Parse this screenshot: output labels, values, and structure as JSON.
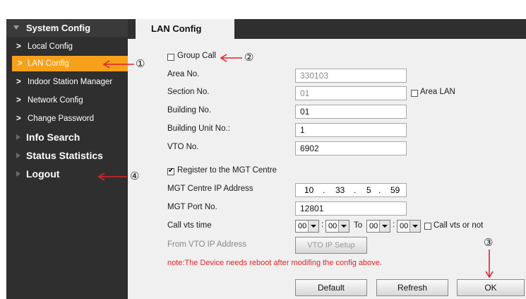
{
  "sidebar": {
    "header": "System Config",
    "sub_items": [
      "Local Config",
      "LAN Config",
      "Indoor Station Manager",
      "Network Config",
      "Change Password"
    ],
    "main_items": [
      "Info Search",
      "Status Statistics",
      "Logout"
    ]
  },
  "tab": {
    "label": "LAN Config"
  },
  "form": {
    "group_call": "Group Call",
    "area_no_label": "Area No.",
    "area_no_value": "330103",
    "section_no_label": "Section No.",
    "section_no_value": "01",
    "area_lan_label": "Area LAN",
    "building_no_label": "Building No.",
    "building_no_value": "01",
    "building_unit_label": "Building Unit No.:",
    "building_unit_value": "1",
    "vto_no_label": "VTO No.",
    "vto_no_value": "6902",
    "register_label": "Register to the MGT Centre",
    "mgt_ip_label": "MGT Centre IP Address",
    "ip": [
      "10",
      "33",
      "5",
      "59"
    ],
    "ip_sep": ".",
    "mgt_port_label": "MGT Port No.",
    "mgt_port_value": "12801",
    "call_vts_label": "Call vts time",
    "time_from_h": "00",
    "time_from_m": "00",
    "to_label": "To",
    "time_to_h": "00",
    "time_to_m": "00",
    "colon": ":",
    "call_vts_or_not": "Call vts or not",
    "from_vto_label": "From VTO IP Address",
    "vto_ip_setup": "VTO IP Setup",
    "note": "note:The Device needs reboot after modifing the config above."
  },
  "buttons": {
    "default": "Default",
    "refresh": "Refresh",
    "ok": "OK"
  },
  "annotations": [
    "①",
    "②",
    "③",
    "④"
  ],
  "colors": {
    "sidebar_bg": "#2f2f2f",
    "active": "#f7a11b",
    "note": "#e0232a",
    "arrow": "#e0232a"
  }
}
